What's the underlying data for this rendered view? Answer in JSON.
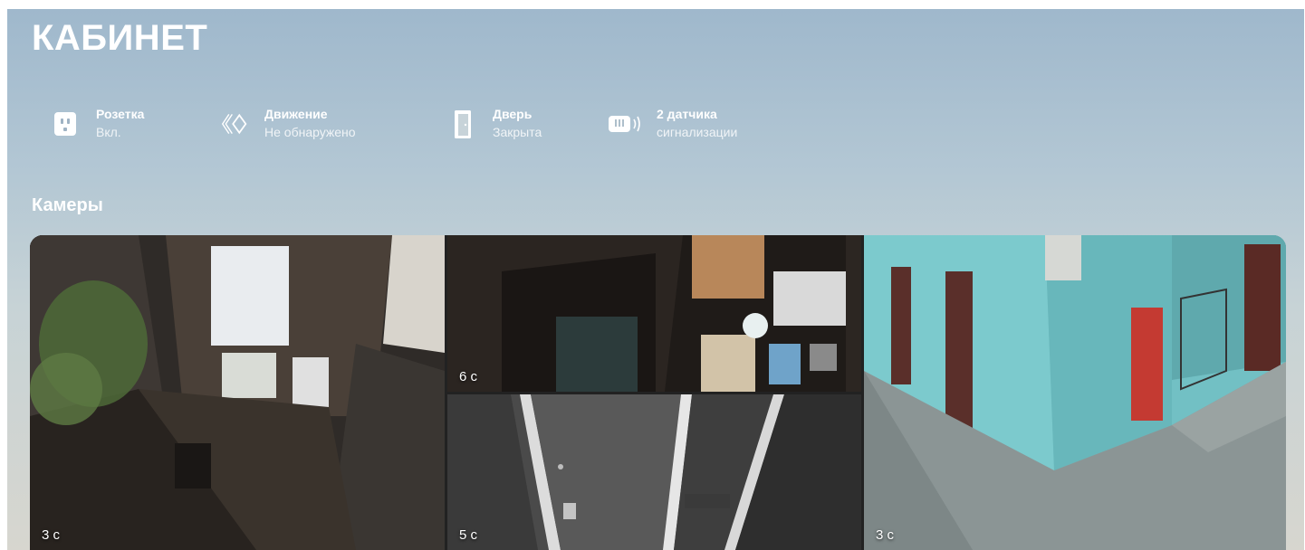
{
  "room": {
    "title": "КАБИНЕТ"
  },
  "sensors": [
    {
      "icon": "socket-icon",
      "name": "Розетка",
      "status": "Вкл."
    },
    {
      "icon": "motion-icon",
      "name": "Движение",
      "status": "Не обнаружено"
    },
    {
      "icon": "door-icon",
      "name": "Дверь",
      "status": "Закрыта"
    },
    {
      "icon": "alarm-sensor-icon",
      "name": "2 датчика",
      "status": "сигнализации"
    }
  ],
  "cameras": {
    "section_title": "Камеры",
    "items": [
      {
        "label": "3 с"
      },
      {
        "label": "6 с"
      },
      {
        "label": "5 с"
      },
      {
        "label": "3 с"
      }
    ]
  }
}
